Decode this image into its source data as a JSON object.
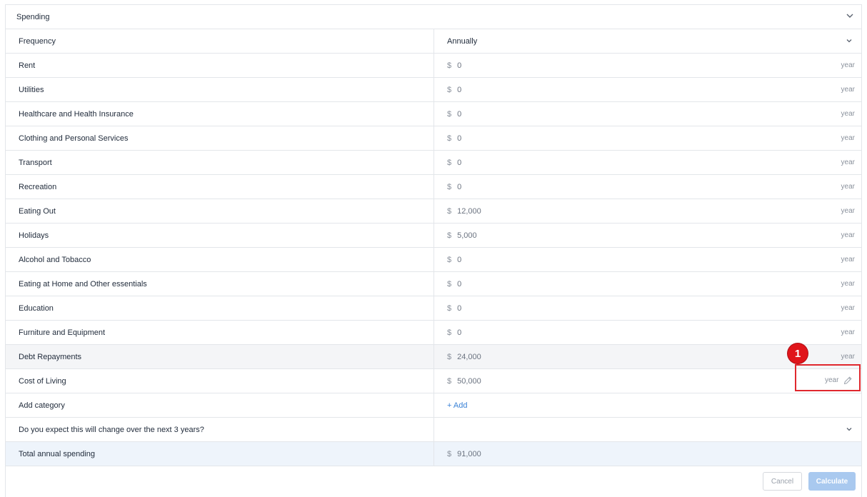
{
  "section": {
    "title": "Spending"
  },
  "frequency": {
    "label": "Frequency",
    "value": "Annually"
  },
  "currency_symbol": "$",
  "unit_label": "year",
  "categories": [
    {
      "label": "Rent",
      "amount": "0"
    },
    {
      "label": "Utilities",
      "amount": "0"
    },
    {
      "label": "Healthcare and Health Insurance",
      "amount": "0"
    },
    {
      "label": "Clothing and Personal Services",
      "amount": "0"
    },
    {
      "label": "Transport",
      "amount": "0"
    },
    {
      "label": "Recreation",
      "amount": "0"
    },
    {
      "label": "Eating Out",
      "amount": "12,000"
    },
    {
      "label": "Holidays",
      "amount": "5,000"
    },
    {
      "label": "Alcohol and Tobacco",
      "amount": "0"
    },
    {
      "label": "Eating at Home and Other essentials",
      "amount": "0"
    },
    {
      "label": "Education",
      "amount": "0"
    },
    {
      "label": "Furniture and Equipment",
      "amount": "0"
    },
    {
      "label": "Debt Repayments",
      "amount": "24,000"
    },
    {
      "label": "Cost of Living",
      "amount": "50,000"
    }
  ],
  "add_category": {
    "label": "Add category",
    "link": "+ Add"
  },
  "change_question": {
    "label": "Do you expect this will change over the next 3 years?"
  },
  "total": {
    "label": "Total annual spending",
    "amount": "91,000"
  },
  "buttons": {
    "cancel": "Cancel",
    "calculate": "Calculate"
  },
  "annotation": {
    "marker": "1"
  },
  "colors": {
    "accent": "#3b82d6",
    "marker": "#e0151b",
    "highlight_box": "#e0282e",
    "total_bg": "#eef4fb"
  }
}
